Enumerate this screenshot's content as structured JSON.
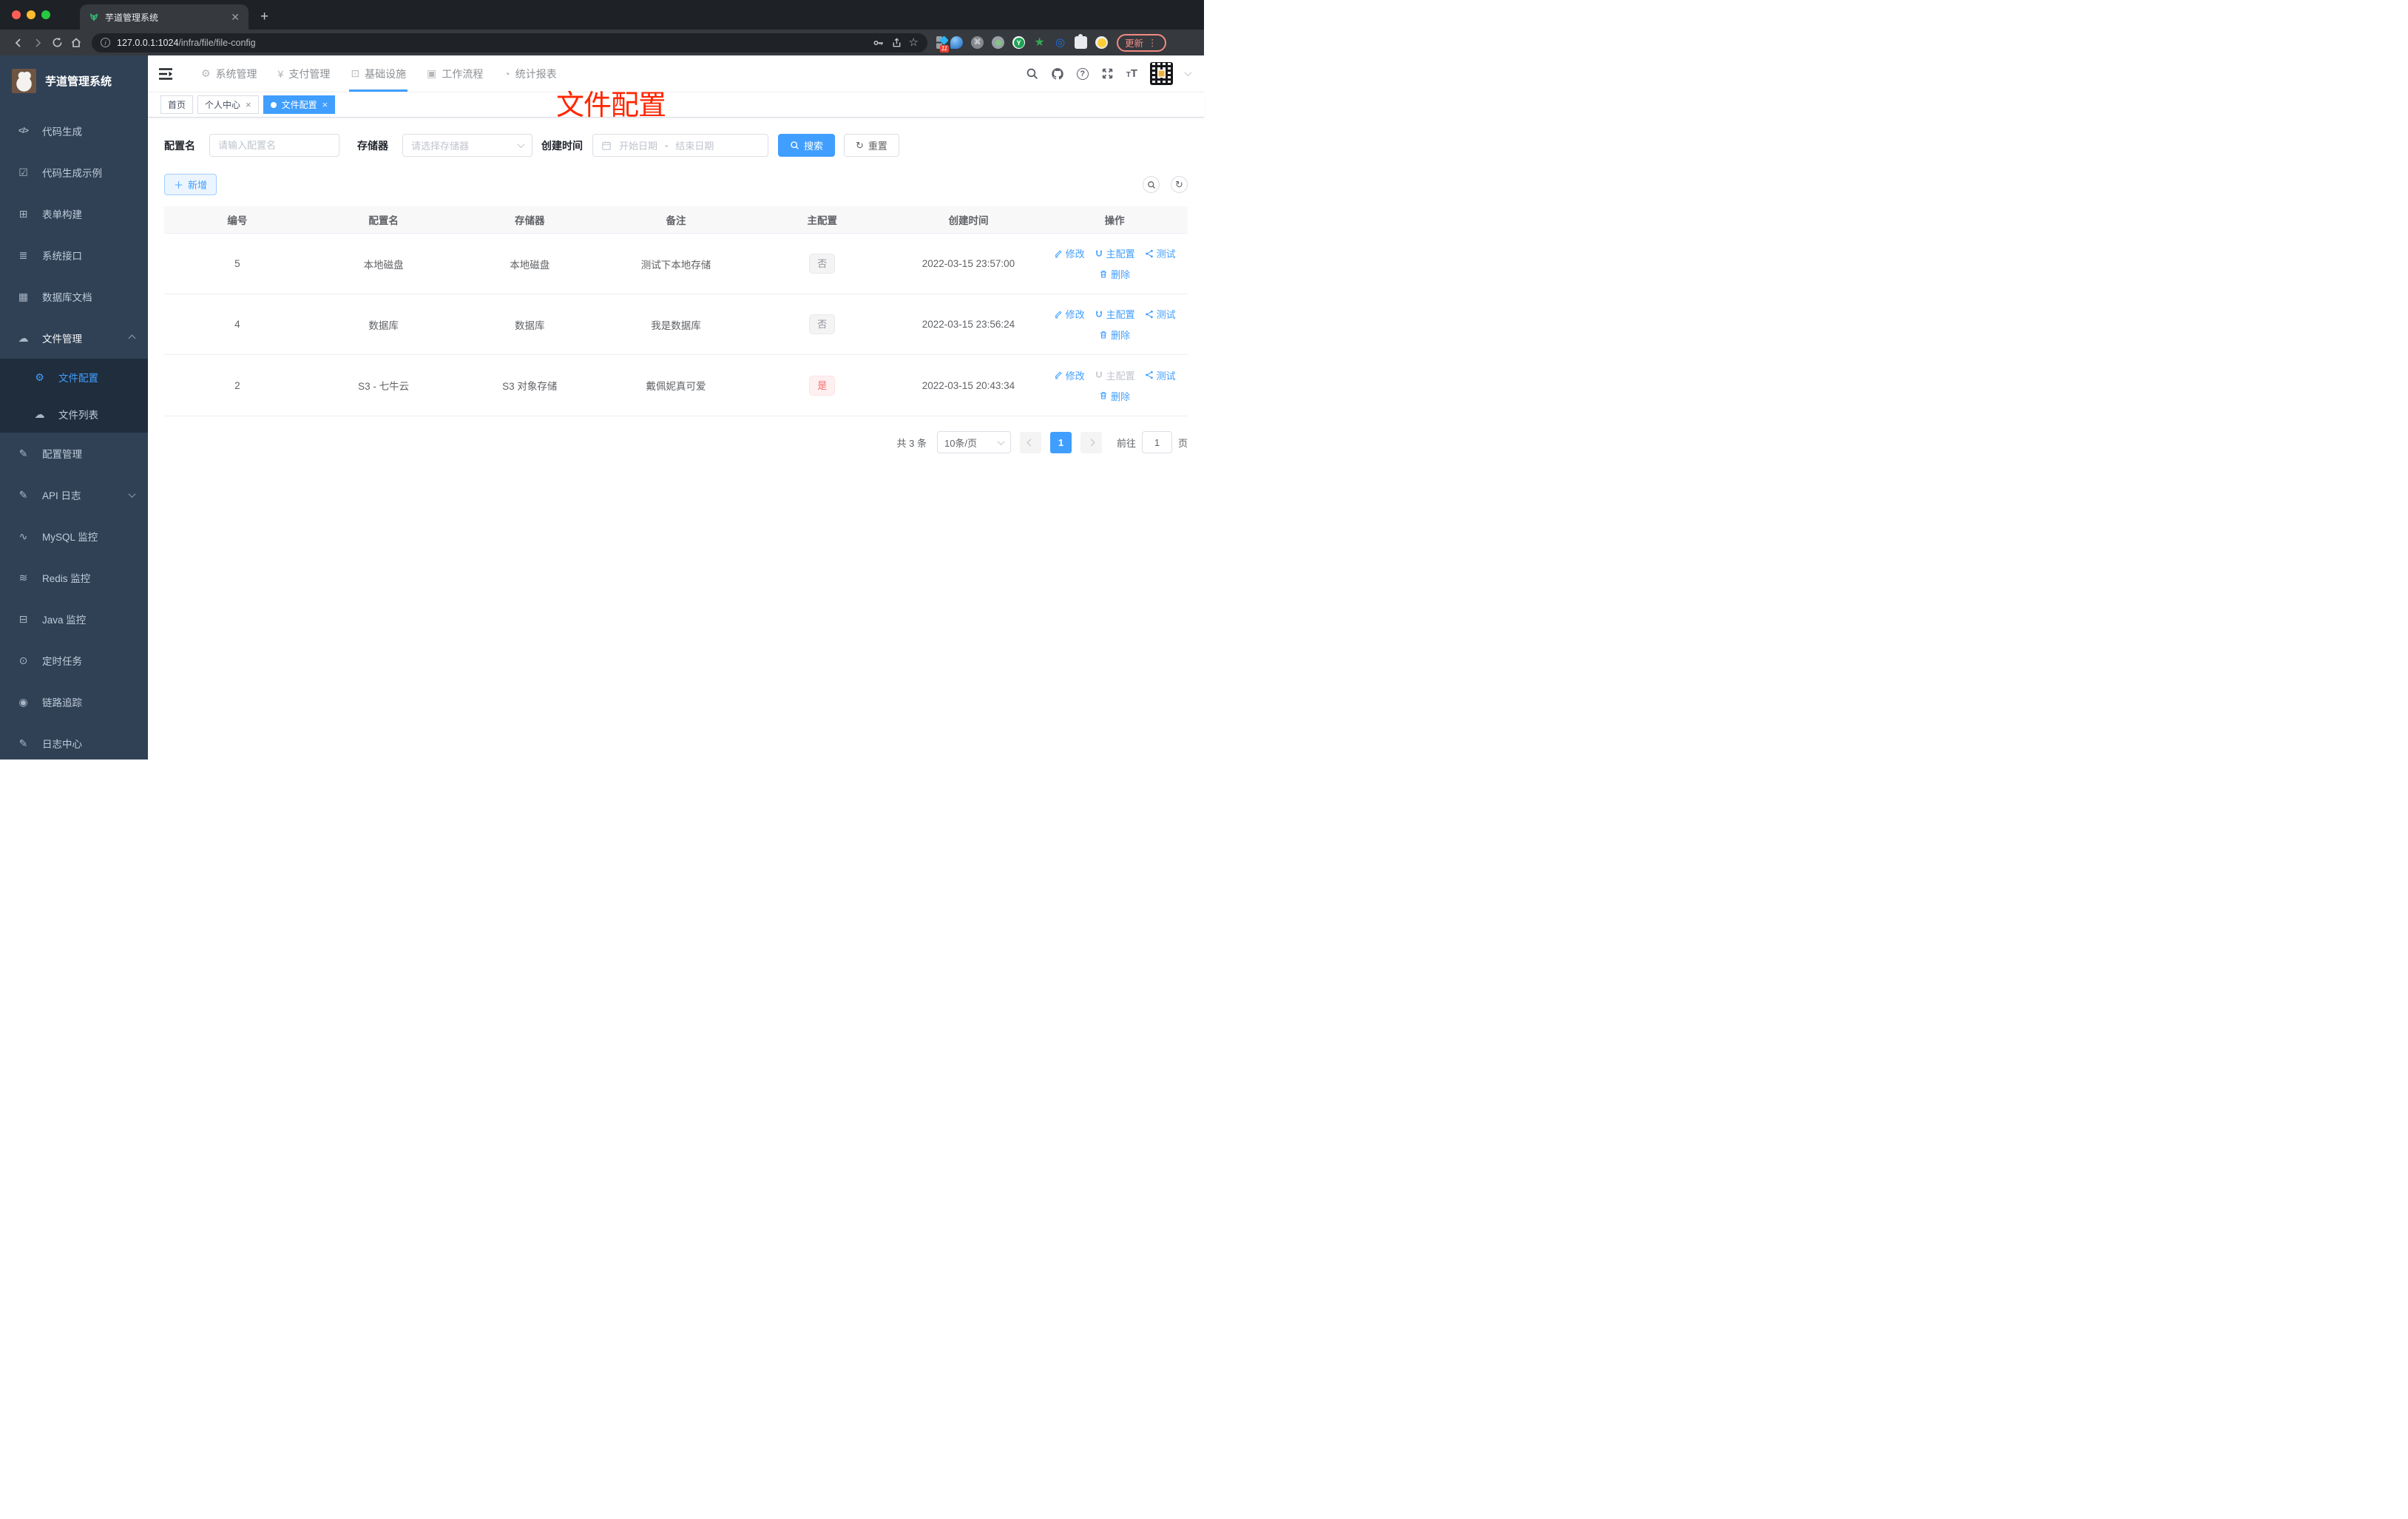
{
  "colors": {
    "accent": "#409eff",
    "annotation_red": "#ff2600",
    "tag_info_text": "#909399",
    "tag_danger_text": "#f56c6c",
    "sidebar_bg": "#304156"
  },
  "browser": {
    "tab_title": "芋道管理系统",
    "url_host": "127.0.0.1:1024",
    "url_path": "/infra/file/file-config",
    "extension_badge": "11",
    "update_label": "更新"
  },
  "sidebar": {
    "title": "芋道管理系统",
    "items": [
      {
        "label": "代码生成"
      },
      {
        "label": "代码生成示例"
      },
      {
        "label": "表单构建"
      },
      {
        "label": "系统接口"
      },
      {
        "label": "数据库文档"
      },
      {
        "label": "文件管理"
      },
      {
        "label": "文件配置"
      },
      {
        "label": "文件列表"
      },
      {
        "label": "配置管理"
      },
      {
        "label": "API 日志"
      },
      {
        "label": "MySQL 监控"
      },
      {
        "label": "Redis 监控"
      },
      {
        "label": "Java 监控"
      },
      {
        "label": "定时任务"
      },
      {
        "label": "链路追踪"
      },
      {
        "label": "日志中心"
      }
    ]
  },
  "topnav": {
    "items": [
      "系统管理",
      "支付管理",
      "基础设施",
      "工作流程",
      "统计报表"
    ]
  },
  "tags": {
    "items": [
      "首页",
      "个人中心",
      "文件配置"
    ]
  },
  "annotation": "文件配置",
  "filters": {
    "name_label": "配置名",
    "name_placeholder": "请输入配置名",
    "storage_label": "存储器",
    "storage_placeholder": "请选择存储器",
    "time_label": "创建时间",
    "start_placeholder": "开始日期",
    "separator": "-",
    "end_placeholder": "结束日期",
    "search_label": "搜索",
    "reset_label": "重置"
  },
  "toolbar": {
    "add_label": "新增"
  },
  "table": {
    "headers": [
      "编号",
      "配置名",
      "存储器",
      "备注",
      "主配置",
      "创建时间",
      "操作"
    ],
    "actions": {
      "edit": "修改",
      "master": "主配置",
      "test": "测试",
      "delete": "删除"
    },
    "rows": [
      {
        "id": "5",
        "name": "本地磁盘",
        "storage": "本地磁盘",
        "remark": "测试下本地存储",
        "master": "否",
        "time": "2022-03-15 23:57:00"
      },
      {
        "id": "4",
        "name": "数据库",
        "storage": "数据库",
        "remark": "我是数据库",
        "master": "否",
        "time": "2022-03-15 23:56:24"
      },
      {
        "id": "2",
        "name": "S3 - 七牛云",
        "storage": "S3 对象存储",
        "remark": "戴佩妮真可爱",
        "master": "是",
        "time": "2022-03-15 20:43:34"
      }
    ]
  },
  "pagination": {
    "total": "共 3 条",
    "page_size": "10条/页",
    "page": "1",
    "goto_label": "前往",
    "goto_value": "1",
    "unit_label": "页"
  }
}
